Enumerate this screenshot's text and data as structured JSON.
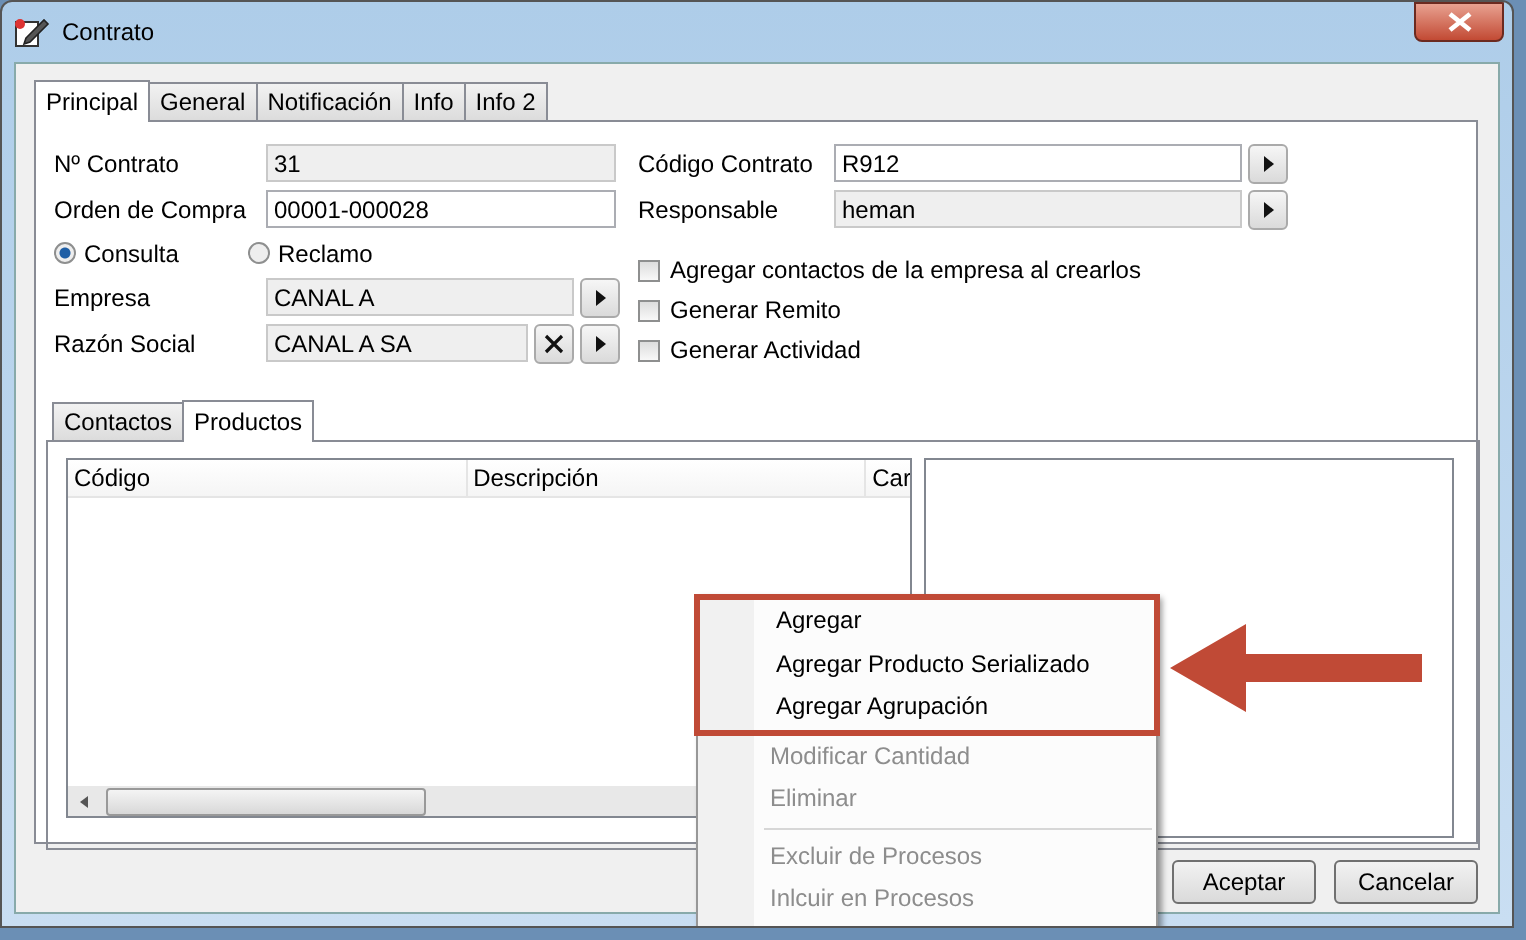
{
  "window": {
    "title": "Contrato"
  },
  "tabs": [
    {
      "label": "Principal",
      "selected": true
    },
    {
      "label": "General",
      "selected": false
    },
    {
      "label": "Notificación",
      "selected": false
    },
    {
      "label": "Info",
      "selected": false
    },
    {
      "label": "Info 2",
      "selected": false
    }
  ],
  "left_fields": [
    {
      "label": "Nº Contrato",
      "value": "31",
      "readonly": true
    },
    {
      "label": "Orden de Compra",
      "value": "00001-000028",
      "readonly": false
    }
  ],
  "radios": [
    {
      "label": "Consulta",
      "selected": true
    },
    {
      "label": "Reclamo",
      "selected": false
    }
  ],
  "lower_fields": [
    {
      "label": "Empresa",
      "value": "CANAL A",
      "readonly": true,
      "buttons": [
        {
          "kind": "open"
        }
      ]
    },
    {
      "label": "Razón Social",
      "value": "CANAL A SA",
      "readonly": true,
      "buttons": [
        {
          "kind": "clear"
        },
        {
          "kind": "open"
        }
      ]
    }
  ],
  "right_fields": [
    {
      "label": "Código Contrato",
      "value": "R912",
      "readonly": false,
      "buttons": [
        {
          "kind": "open"
        }
      ]
    },
    {
      "label": "Responsable",
      "value": "heman",
      "readonly": true,
      "buttons": [
        {
          "kind": "open"
        }
      ]
    }
  ],
  "checkboxes": [
    {
      "label": "Agregar contactos de la empresa al crearlos",
      "checked": false
    },
    {
      "label": "Generar Remito",
      "checked": false
    },
    {
      "label": "Generar Actividad",
      "checked": false
    }
  ],
  "subtabs": [
    {
      "label": "Contactos",
      "selected": false
    },
    {
      "label": "Productos",
      "selected": true
    }
  ],
  "table": {
    "columns": [
      "Código",
      "Descripción",
      "Car"
    ]
  },
  "context_menu": [
    {
      "kind": "item",
      "label": "Agregar",
      "disabled": false,
      "highlighted": true
    },
    {
      "kind": "item",
      "label": "Agregar Producto Serializado",
      "disabled": false,
      "highlighted": true
    },
    {
      "kind": "item",
      "label": "Agregar Agrupación",
      "disabled": false,
      "highlighted": true
    },
    {
      "kind": "item",
      "label": "Modificar Cantidad",
      "disabled": true,
      "highlighted": false
    },
    {
      "kind": "item",
      "label": "Eliminar",
      "disabled": true,
      "highlighted": false
    },
    {
      "kind": "separator"
    },
    {
      "kind": "item",
      "label": "Excluir de Procesos",
      "disabled": true,
      "highlighted": false
    },
    {
      "kind": "item",
      "label": "Inlcuir en Procesos",
      "disabled": true,
      "highlighted": false
    }
  ],
  "buttons": [
    "Aceptar",
    "Cancelar"
  ]
}
